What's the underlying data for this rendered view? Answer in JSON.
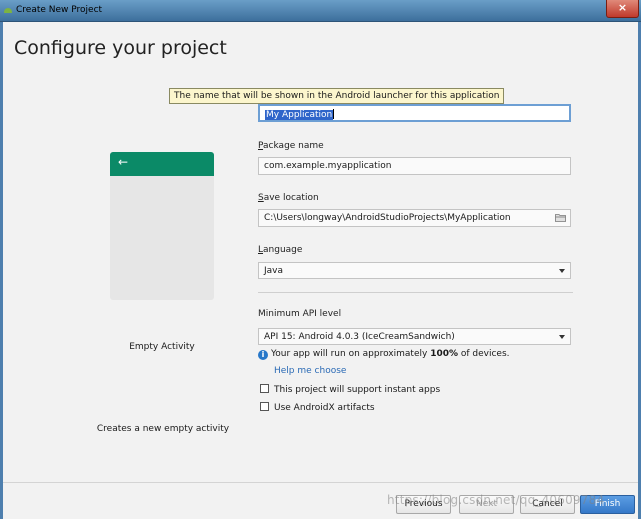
{
  "window": {
    "title": "Create New Project",
    "close_glyph": "×"
  },
  "header": {
    "heading": "Configure your project"
  },
  "template": {
    "name": "Empty Activity",
    "description": "Creates a new empty activity",
    "back_glyph": "←"
  },
  "tooltip": "The name that will be shown in the Android launcher for this application",
  "form": {
    "name": {
      "label_rest": "",
      "value": "My Application"
    },
    "package": {
      "label_first": "P",
      "label_rest": "ackage name",
      "value": "com.example.myapplication"
    },
    "save_location": {
      "label_first": "S",
      "label_rest": "ave location",
      "value": "C:\\Users\\longway\\AndroidStudioProjects\\MyApplication"
    },
    "language": {
      "label_first": "L",
      "label_rest": "anguage",
      "value": "Java"
    },
    "min_api": {
      "label": "Minimum API level",
      "value": "API 15: Android 4.0.3 (IceCreamSandwich)"
    },
    "info": {
      "before": "Your app will run on approximately ",
      "percent": "100%",
      "after": " of devices."
    },
    "help_link": "Help me choose",
    "instant_apps": {
      "label": "This project will support instant apps",
      "checked": false
    },
    "androidx": {
      "label": "Use AndroidX artifacts",
      "checked": false
    }
  },
  "footer": {
    "previous": "Previous",
    "next": "Next",
    "cancel": "Cancel",
    "finish": "Finish",
    "watermark": "https://blog.csdn.net/qq_40609784"
  },
  "colors": {
    "accent": "#0b8a67",
    "link": "#2a6ab5",
    "primary_button": "#3578c8",
    "titlebar": "#3d6f9c"
  },
  "icons": [
    "android-app-icon",
    "close-icon",
    "back-arrow-icon",
    "folder-icon",
    "chevron-down-icon",
    "info-icon"
  ]
}
